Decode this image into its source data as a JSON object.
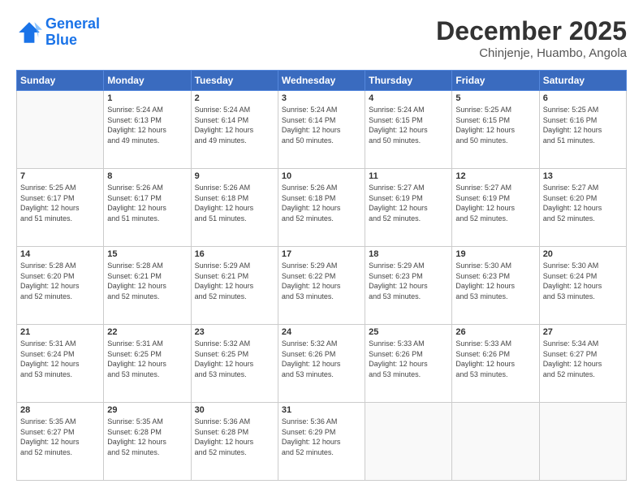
{
  "logo": {
    "line1": "General",
    "line2": "Blue"
  },
  "title": "December 2025",
  "subtitle": "Chinjenje, Huambo, Angola",
  "header_days": [
    "Sunday",
    "Monday",
    "Tuesday",
    "Wednesday",
    "Thursday",
    "Friday",
    "Saturday"
  ],
  "weeks": [
    [
      {
        "day": "",
        "info": ""
      },
      {
        "day": "1",
        "info": "Sunrise: 5:24 AM\nSunset: 6:13 PM\nDaylight: 12 hours\nand 49 minutes."
      },
      {
        "day": "2",
        "info": "Sunrise: 5:24 AM\nSunset: 6:14 PM\nDaylight: 12 hours\nand 49 minutes."
      },
      {
        "day": "3",
        "info": "Sunrise: 5:24 AM\nSunset: 6:14 PM\nDaylight: 12 hours\nand 50 minutes."
      },
      {
        "day": "4",
        "info": "Sunrise: 5:24 AM\nSunset: 6:15 PM\nDaylight: 12 hours\nand 50 minutes."
      },
      {
        "day": "5",
        "info": "Sunrise: 5:25 AM\nSunset: 6:15 PM\nDaylight: 12 hours\nand 50 minutes."
      },
      {
        "day": "6",
        "info": "Sunrise: 5:25 AM\nSunset: 6:16 PM\nDaylight: 12 hours\nand 51 minutes."
      }
    ],
    [
      {
        "day": "7",
        "info": "Sunrise: 5:25 AM\nSunset: 6:17 PM\nDaylight: 12 hours\nand 51 minutes."
      },
      {
        "day": "8",
        "info": "Sunrise: 5:26 AM\nSunset: 6:17 PM\nDaylight: 12 hours\nand 51 minutes."
      },
      {
        "day": "9",
        "info": "Sunrise: 5:26 AM\nSunset: 6:18 PM\nDaylight: 12 hours\nand 51 minutes."
      },
      {
        "day": "10",
        "info": "Sunrise: 5:26 AM\nSunset: 6:18 PM\nDaylight: 12 hours\nand 52 minutes."
      },
      {
        "day": "11",
        "info": "Sunrise: 5:27 AM\nSunset: 6:19 PM\nDaylight: 12 hours\nand 52 minutes."
      },
      {
        "day": "12",
        "info": "Sunrise: 5:27 AM\nSunset: 6:19 PM\nDaylight: 12 hours\nand 52 minutes."
      },
      {
        "day": "13",
        "info": "Sunrise: 5:27 AM\nSunset: 6:20 PM\nDaylight: 12 hours\nand 52 minutes."
      }
    ],
    [
      {
        "day": "14",
        "info": "Sunrise: 5:28 AM\nSunset: 6:20 PM\nDaylight: 12 hours\nand 52 minutes."
      },
      {
        "day": "15",
        "info": "Sunrise: 5:28 AM\nSunset: 6:21 PM\nDaylight: 12 hours\nand 52 minutes."
      },
      {
        "day": "16",
        "info": "Sunrise: 5:29 AM\nSunset: 6:21 PM\nDaylight: 12 hours\nand 52 minutes."
      },
      {
        "day": "17",
        "info": "Sunrise: 5:29 AM\nSunset: 6:22 PM\nDaylight: 12 hours\nand 53 minutes."
      },
      {
        "day": "18",
        "info": "Sunrise: 5:29 AM\nSunset: 6:23 PM\nDaylight: 12 hours\nand 53 minutes."
      },
      {
        "day": "19",
        "info": "Sunrise: 5:30 AM\nSunset: 6:23 PM\nDaylight: 12 hours\nand 53 minutes."
      },
      {
        "day": "20",
        "info": "Sunrise: 5:30 AM\nSunset: 6:24 PM\nDaylight: 12 hours\nand 53 minutes."
      }
    ],
    [
      {
        "day": "21",
        "info": "Sunrise: 5:31 AM\nSunset: 6:24 PM\nDaylight: 12 hours\nand 53 minutes."
      },
      {
        "day": "22",
        "info": "Sunrise: 5:31 AM\nSunset: 6:25 PM\nDaylight: 12 hours\nand 53 minutes."
      },
      {
        "day": "23",
        "info": "Sunrise: 5:32 AM\nSunset: 6:25 PM\nDaylight: 12 hours\nand 53 minutes."
      },
      {
        "day": "24",
        "info": "Sunrise: 5:32 AM\nSunset: 6:26 PM\nDaylight: 12 hours\nand 53 minutes."
      },
      {
        "day": "25",
        "info": "Sunrise: 5:33 AM\nSunset: 6:26 PM\nDaylight: 12 hours\nand 53 minutes."
      },
      {
        "day": "26",
        "info": "Sunrise: 5:33 AM\nSunset: 6:26 PM\nDaylight: 12 hours\nand 53 minutes."
      },
      {
        "day": "27",
        "info": "Sunrise: 5:34 AM\nSunset: 6:27 PM\nDaylight: 12 hours\nand 52 minutes."
      }
    ],
    [
      {
        "day": "28",
        "info": "Sunrise: 5:35 AM\nSunset: 6:27 PM\nDaylight: 12 hours\nand 52 minutes."
      },
      {
        "day": "29",
        "info": "Sunrise: 5:35 AM\nSunset: 6:28 PM\nDaylight: 12 hours\nand 52 minutes."
      },
      {
        "day": "30",
        "info": "Sunrise: 5:36 AM\nSunset: 6:28 PM\nDaylight: 12 hours\nand 52 minutes."
      },
      {
        "day": "31",
        "info": "Sunrise: 5:36 AM\nSunset: 6:29 PM\nDaylight: 12 hours\nand 52 minutes."
      },
      {
        "day": "",
        "info": ""
      },
      {
        "day": "",
        "info": ""
      },
      {
        "day": "",
        "info": ""
      }
    ]
  ]
}
